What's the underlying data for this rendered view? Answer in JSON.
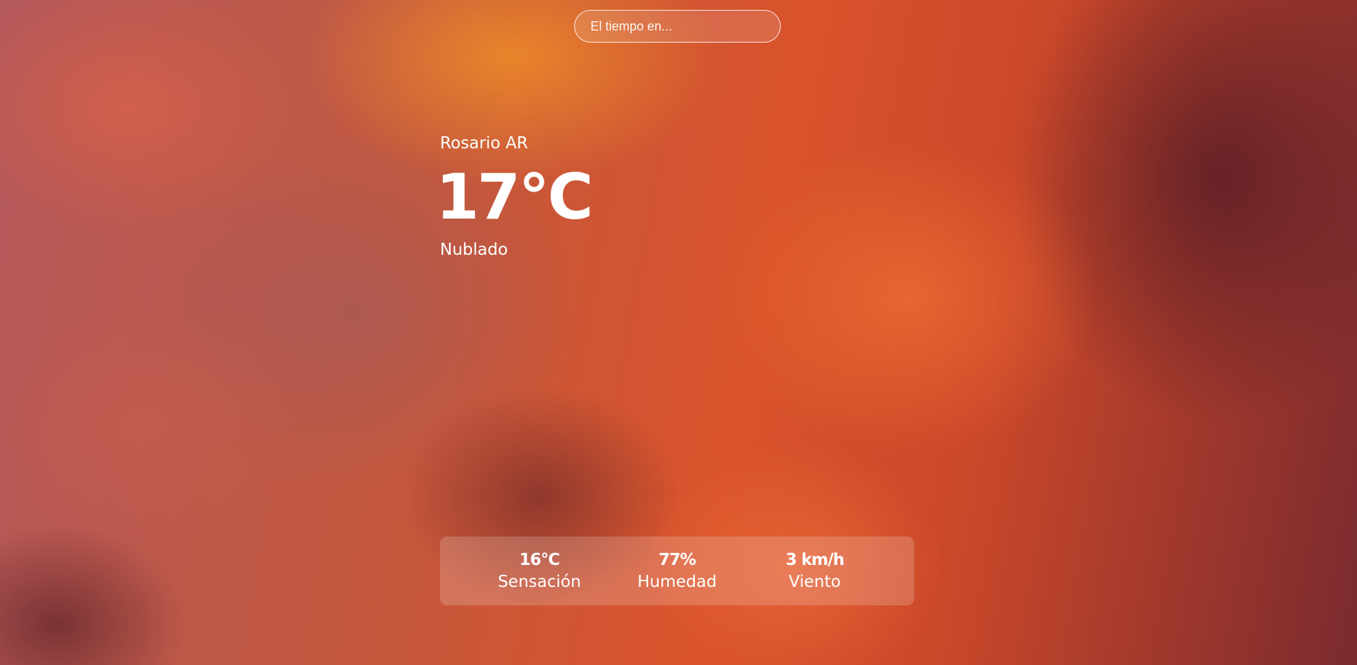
{
  "search": {
    "placeholder": "El tiempo en..."
  },
  "weather": {
    "city": "Rosario AR",
    "temperature": "17°C",
    "description": "Nublado"
  },
  "details": [
    {
      "value": "16°C",
      "label": "Sensación"
    },
    {
      "value": "77%",
      "label": "Humedad"
    },
    {
      "value": "3 km/h",
      "label": "Viento"
    }
  ]
}
